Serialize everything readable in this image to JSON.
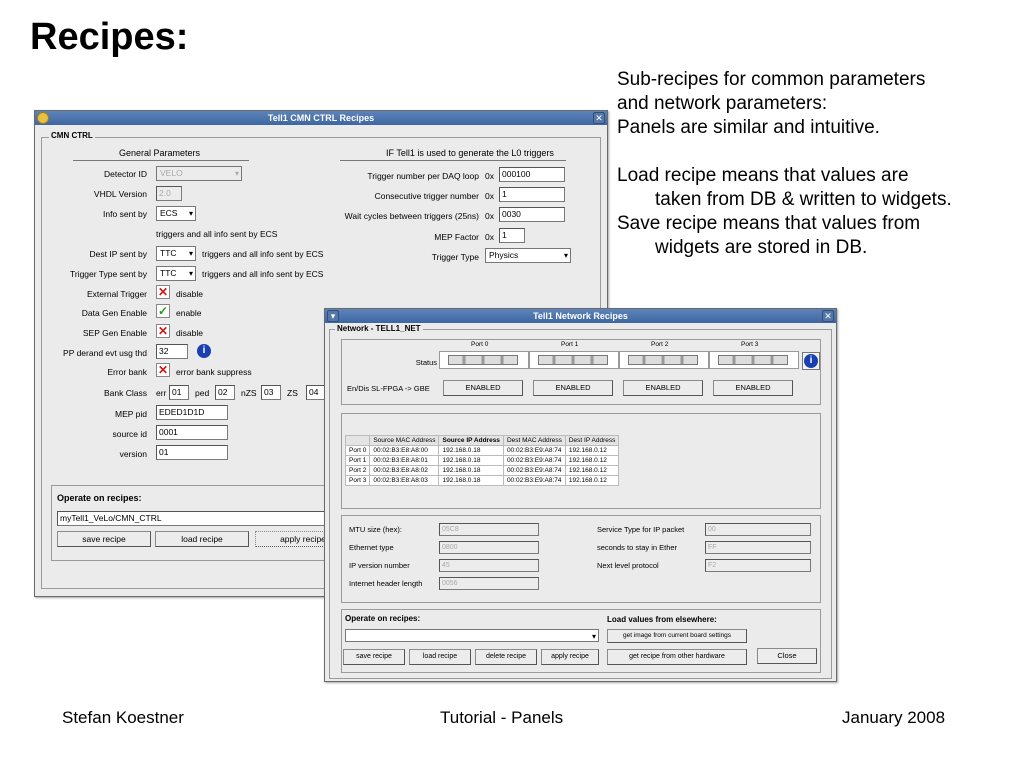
{
  "slide": {
    "title": "Recipes:",
    "notes": [
      "Sub-recipes for common parameters",
      "and network parameters:",
      "Panels are similar and intuitive.",
      "Load recipe means that values are",
      "taken from DB & written to widgets.",
      "Save recipe means that values from",
      "widgets are stored in DB."
    ],
    "footer": {
      "author": "Stefan Koestner",
      "center": "Tutorial - Panels",
      "date": "January 2008"
    }
  },
  "cmn_window": {
    "title": "Tell1 CMN CTRL Recipes",
    "group_label": "CMN CTRL",
    "general_header": "General Parameters",
    "if_header": "IF Tell1 is used to generate the L0 triggers",
    "fields": {
      "detector_id": {
        "label": "Detector ID",
        "value": "VELO"
      },
      "vhdl_version": {
        "label": "VHDL Version",
        "value": "2.0"
      },
      "info_sent_by": {
        "label": "Info sent by",
        "value": "ECS"
      },
      "triggers_note": "triggers and all info sent by ECS",
      "dest_ip_sent_by": {
        "label": "Dest IP sent by",
        "value": "TTC",
        "note": "triggers and all info sent by ECS"
      },
      "trigger_type_sent_by": {
        "label": "Trigger Type sent by",
        "value": "TTC",
        "note": "triggers and all info sent by ECS"
      },
      "external_trigger": {
        "label": "External Trigger",
        "note": "disable"
      },
      "data_gen_enable": {
        "label": "Data Gen Enable",
        "note": "enable"
      },
      "sep_gen_enable": {
        "label": "SEP Gen Enable",
        "note": "disable"
      },
      "pp_derand": {
        "label": "PP derand evt usg thd",
        "value": "32"
      },
      "error_bank": {
        "label": "Error bank",
        "note": "error bank suppress"
      },
      "bank_class": {
        "label": "Bank Class",
        "err_label": "err",
        "err": "01",
        "ped_label": "ped",
        "ped": "02",
        "nzs_label": "nZS",
        "nzs": "03",
        "zs_label": "ZS",
        "zs": "04"
      },
      "mep_pid": {
        "label": "MEP pid",
        "value": "EDED1D1D"
      },
      "source_id": {
        "label": "source id",
        "value": "0001"
      },
      "version": {
        "label": "version",
        "value": "01"
      }
    },
    "trigger": {
      "per_daq_loop": {
        "label": "Trigger number per DAQ loop",
        "prefix": "0x",
        "value": "000100"
      },
      "consecutive": {
        "label": "Consecutive trigger number",
        "prefix": "0x",
        "value": "1"
      },
      "wait_cycles": {
        "label": "Wait cycles between triggers (25ns)",
        "prefix": "0x",
        "value": "0030"
      },
      "mep_factor": {
        "label": "MEP Factor",
        "prefix": "0x",
        "value": "1"
      },
      "trigger_type": {
        "label": "Trigger Type",
        "value": "Physics"
      }
    },
    "operate": {
      "label": "Operate on recipes:",
      "recipe_value": "myTell1_VeLo/CMN_CTRL",
      "save": "save recipe",
      "load": "load recipe",
      "apply": "apply recipe"
    }
  },
  "net_window": {
    "title": "Tell1 Network Recipes",
    "group_label": "Network - TELL1_NET",
    "ports": [
      "Port 0",
      "Port 1",
      "Port 2",
      "Port 3"
    ],
    "status_label": "Status",
    "gbe_label": "En/Dis SL-FPGA -> GBE",
    "enabled_labels": [
      "ENABLED",
      "ENABLED",
      "ENABLED",
      "ENABLED"
    ],
    "table": {
      "columns": [
        "",
        "Source MAC Address",
        "Source IP Address",
        "Dest MAC Address",
        "Dest IP Address"
      ],
      "rows": [
        [
          "Port 0",
          "00:02:B3:E8:A8:00",
          "192.168.0.18",
          "00:02:B3:E9:A8:74",
          "192.168.0.12"
        ],
        [
          "Port 1",
          "00:02:B3:E8:A8:01",
          "192.168.0.18",
          "00:02:B3:E9:A8:74",
          "192.168.0.12"
        ],
        [
          "Port 2",
          "00:02:B3:E8:A8:02",
          "192.168.0.18",
          "00:02:B3:E9:A8:74",
          "192.168.0.12"
        ],
        [
          "Port 3",
          "00:02:B3:E8:A8:03",
          "192.168.0.18",
          "00:02:B3:E9:A8:74",
          "192.168.0.12"
        ]
      ]
    },
    "params": {
      "mtu": {
        "label": "MTU size (hex):",
        "value": "05C8"
      },
      "eth_type": {
        "label": "Ethernet type",
        "value": "0800"
      },
      "ip_version": {
        "label": "IP version number",
        "value": "45"
      },
      "inet_header": {
        "label": "Internet header length",
        "value": "0056"
      },
      "service_type": {
        "label": "Service Type for IP packet",
        "value": "00"
      },
      "seconds_ether": {
        "label": "seconds to stay in Ether",
        "value": "FF"
      },
      "next_level": {
        "label": "Next level protocol",
        "value": "F2"
      }
    },
    "operate": {
      "label": "Operate on recipes:",
      "load_else_label": "Load values from elsewhere:",
      "save": "save recipe",
      "load": "load recipe",
      "delete": "delete recipe",
      "apply": "apply recipe",
      "get_image": "get image from current board settings",
      "get_recipe": "get recipe from other hardware",
      "close": "Close"
    }
  }
}
